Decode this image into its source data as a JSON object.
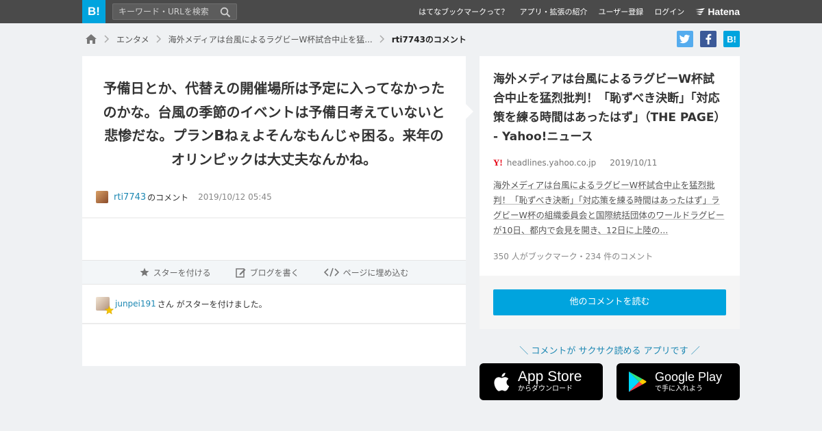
{
  "header": {
    "logo": "B!",
    "search_placeholder": "キーワード・URLを検索",
    "nav": [
      "はてなブックマークって？",
      "アプリ・拡張の紹介",
      "ユーザー登録",
      "ログイン"
    ],
    "brand": "Hatena"
  },
  "breadcrumb": {
    "items": [
      "エンタメ",
      "海外メディアは台風によるラグビーW杯試合中止を猛...",
      "rti7743のコメント"
    ]
  },
  "social": {
    "twitter": "t",
    "facebook": "f",
    "hatena": "B!"
  },
  "comment": {
    "text": "予備日とか、代替えの開催場所は予定に入ってなかったのかな。台風の季節のイベントは予備日考えていないと悲惨だな。プランBねぇよそんなもんじゃ困る。来年のオリンピックは大丈夫なんかね。",
    "user": "rti7743",
    "user_suffix": "のコメント",
    "date": "2019/10/12 05:45"
  },
  "actions": {
    "star": "スターを付ける",
    "blog": "ブログを書く",
    "embed": "ページに埋め込む"
  },
  "stars": {
    "user": "junpei191",
    "text": "さん がスターを付けました。"
  },
  "article": {
    "title": "海外メディアは台風によるラグビーW杯試合中止を猛烈批判！「恥ずべき決断」「対応策を練る時間はあったはず」（THE PAGE） - Yahoo!ニュース",
    "source_logo": "Y!",
    "domain": "headlines.yahoo.co.jp",
    "date": "2019/10/11",
    "excerpt": "海外メディアは台風によるラグビーW杯試合中止を猛烈批判！「恥ずべき決断」「対応策を練る時間はあったはず」ラグビーW杯の組織委員会と国際統括団体のワールドラグビーが10日、都内で会見を開き、12日に上陸の...",
    "counts": "350 人がブックマーク・234 件のコメント",
    "read_more": "他のコメントを読む"
  },
  "promo": {
    "tagline": "＼ コメントが サクサク読める アプリです ／",
    "app_store": {
      "big": "App Store",
      "small": "からダウンロード"
    },
    "google_play": {
      "big": "Google Play",
      "small": "で手に入れよう"
    }
  },
  "colors": {
    "accent": "#00a4de",
    "topbar": "#4a4a4a",
    "link": "#1d88b3",
    "background": "#eff1f3"
  }
}
